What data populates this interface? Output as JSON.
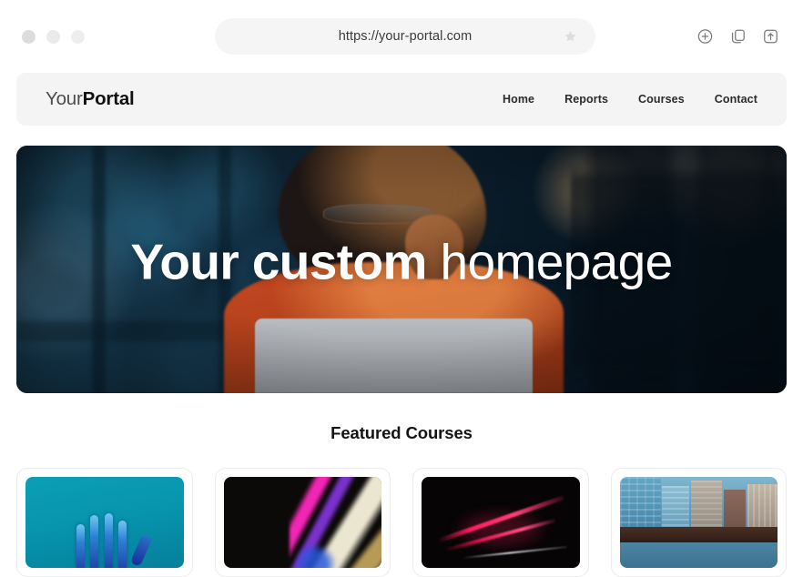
{
  "browser": {
    "traffic_lights": [
      "close",
      "minimize",
      "maximize"
    ],
    "url": "https://your-portal.com",
    "bookmark_icon": "star-icon",
    "actions": [
      {
        "name": "new-tab-icon",
        "label": "New tab"
      },
      {
        "name": "duplicate-tabs-icon",
        "label": "Tabs"
      },
      {
        "name": "share-upload-icon",
        "label": "Share"
      }
    ]
  },
  "site": {
    "logo": {
      "light": "Your",
      "bold": "Portal"
    },
    "nav": [
      {
        "label": "Home"
      },
      {
        "label": "Reports"
      },
      {
        "label": "Courses"
      },
      {
        "label": "Contact"
      }
    ]
  },
  "hero": {
    "title_strong": "Your custom",
    "title_thin": "homepage",
    "image_alt": "Woman with curly hair and glasses in an orange shirt working on a laptop in a dark blue office at night"
  },
  "featured": {
    "heading": "Featured Courses",
    "cards": [
      {
        "name": "course-card-1",
        "image_alt": "Blue robotic hand on teal background"
      },
      {
        "name": "course-card-2",
        "image_alt": "Colorful orange and magenta light streaks"
      },
      {
        "name": "course-card-3",
        "image_alt": "Red neon light trails on black background"
      },
      {
        "name": "course-card-4",
        "image_alt": "City skyline with blue glass and brick buildings"
      }
    ]
  },
  "colors": {
    "page_background": "#ffffff",
    "nav_background": "#f4f4f4",
    "url_background": "#f5f5f5",
    "text_primary": "#111111",
    "hero_dark": "#0a1a26",
    "hero_accent_orange": "#c8481f",
    "card_border": "#ececec"
  }
}
